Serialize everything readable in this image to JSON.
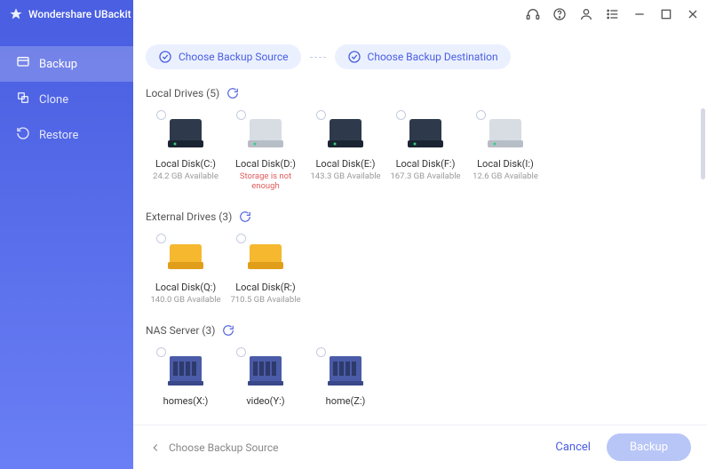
{
  "app": {
    "title": "Wondershare UBackit"
  },
  "sidebar": {
    "items": [
      {
        "label": "Backup",
        "icon": "backup-icon",
        "active": true
      },
      {
        "label": "Clone",
        "icon": "clone-icon",
        "active": false
      },
      {
        "label": "Restore",
        "icon": "restore-icon",
        "active": false
      }
    ]
  },
  "steps": [
    {
      "label": "Choose Backup Source"
    },
    {
      "label": "Choose Backup Destination"
    }
  ],
  "sections": [
    {
      "title": "Local Drives (5)",
      "kind": "local",
      "drives": [
        {
          "name": "Local Disk(C:)",
          "sub": "24.2 GB Available",
          "variant": "dark"
        },
        {
          "name": "Local Disk(D:)",
          "sub": "Storage is not enough",
          "variant": "light",
          "err": true
        },
        {
          "name": "Local Disk(E:)",
          "sub": "143.3 GB Available",
          "variant": "dark"
        },
        {
          "name": "Local Disk(F:)",
          "sub": "167.3 GB Available",
          "variant": "dark"
        },
        {
          "name": "Local Disk(I:)",
          "sub": "12.6 GB Available",
          "variant": "light"
        }
      ]
    },
    {
      "title": "External Drives (3)",
      "kind": "external",
      "drives": [
        {
          "name": "Local Disk(Q:)",
          "sub": "140.0 GB Available",
          "variant": "ext"
        },
        {
          "name": "Local Disk(R:)",
          "sub": "710.5 GB Available",
          "variant": "ext"
        }
      ]
    },
    {
      "title": "NAS Server (3)",
      "kind": "nas",
      "drives": [
        {
          "name": "homes(X:)",
          "sub": "",
          "variant": "nas"
        },
        {
          "name": "video(Y:)",
          "sub": "",
          "variant": "nas"
        },
        {
          "name": "home(Z:)",
          "sub": "",
          "variant": "nas"
        }
      ]
    }
  ],
  "footer": {
    "hint": "Choose Backup Source",
    "cancel": "Cancel",
    "primary": "Backup"
  }
}
